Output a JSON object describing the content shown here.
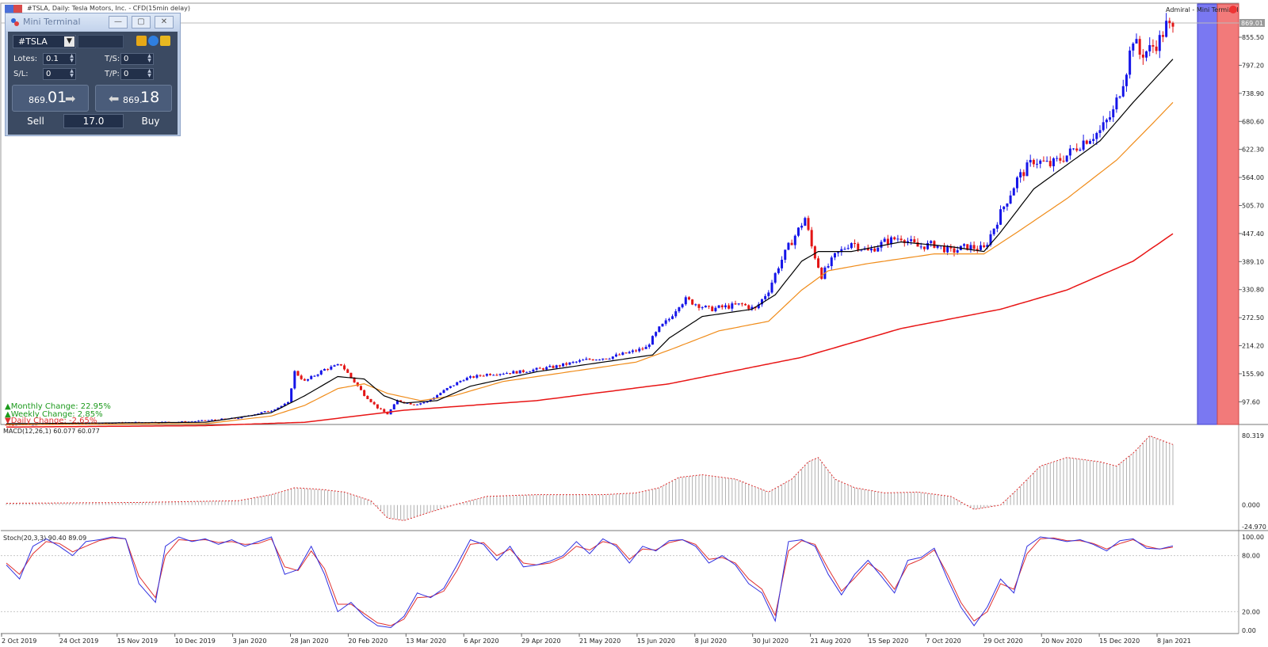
{
  "chart_title": "#TSLA, Daily:  Tesla Motors, Inc. - CFD(15min delay)",
  "top_right_label": "Admiral - Mini Terminal",
  "current_price_tag": "869.01",
  "mini_terminal": {
    "title": "Mini Terminal",
    "symbol": "#TSLA",
    "lots_label": "Lotes:",
    "lots_value": "0.1",
    "ts_label": "T/S:",
    "ts_value": "0",
    "sl_label": "S/L:",
    "sl_value": "0",
    "tp_label": "T/P:",
    "tp_value": "0",
    "sell_price_small": "869.",
    "sell_price_big": "01",
    "buy_price_small": "869.",
    "buy_price_big": "18",
    "sell_label": "Sell",
    "buy_label": "Buy",
    "quantity": "17.0"
  },
  "change_labels": {
    "monthly": "▲Monthly Change: 22.95%",
    "weekly": "▲Weekly Change: 2.85%",
    "daily": "▼Daily Change: -2.65%"
  },
  "macd_label": "MACD(12,26,1) 60.077 60.077",
  "stoch_label": "Stoch(20,3,3) 90.40 89.09",
  "colors": {
    "bull": "#1515e8",
    "bear": "#e31515",
    "ma_fast": "#000000",
    "ma_mid": "#f08c1a",
    "ma_slow": "#e81515",
    "panel_blue": "#7a78f2",
    "panel_red": "#f27a7a",
    "terminal_bg": "#3b4a62"
  },
  "chart_data": [
    {
      "type": "candlestick",
      "title": "#TSLA, Daily:  Tesla Motors, Inc. - CFD(15min delay)",
      "x_tick_labels": [
        "2 Oct 2019",
        "24 Oct 2019",
        "15 Nov 2019",
        "10 Dec 2019",
        "3 Jan 2020",
        "28 Jan 2020",
        "20 Feb 2020",
        "13 Mar 2020",
        "6 Apr 2020",
        "29 Apr 2020",
        "21 May 2020",
        "15 Jun 2020",
        "8 Jul 2020",
        "30 Jul 2020",
        "21 Aug 2020",
        "15 Sep 2020",
        "7 Oct 2020",
        "29 Oct 2020",
        "20 Nov 2020",
        "15 Dec 2020",
        "8 Jan 2021"
      ],
      "y_tick_labels": [
        "855.50",
        "797.20",
        "738.90",
        "680.60",
        "622.30",
        "564.00",
        "505.70",
        "447.40",
        "389.10",
        "330.80",
        "272.50",
        "214.20",
        "155.90",
        "97.60"
      ],
      "y_range": [
        57.0,
        900.0
      ],
      "last_price": 869.01,
      "close_path": [
        [
          0,
          50
        ],
        [
          20,
          52
        ],
        [
          40,
          55
        ],
        [
          55,
          56
        ],
        [
          70,
          64
        ],
        [
          80,
          80
        ],
        [
          85,
          95
        ],
        [
          87,
          160
        ],
        [
          90,
          140
        ],
        [
          96,
          165
        ],
        [
          101,
          175
        ],
        [
          104,
          148
        ],
        [
          108,
          112
        ],
        [
          112,
          85
        ],
        [
          115,
          72
        ],
        [
          118,
          100
        ],
        [
          123,
          92
        ],
        [
          127,
          98
        ],
        [
          133,
          125
        ],
        [
          138,
          145
        ],
        [
          145,
          155
        ],
        [
          155,
          160
        ],
        [
          165,
          170
        ],
        [
          175,
          185
        ],
        [
          182,
          190
        ],
        [
          188,
          200
        ],
        [
          193,
          210
        ],
        [
          197,
          250
        ],
        [
          200,
          270
        ],
        [
          203,
          300
        ],
        [
          205,
          310
        ],
        [
          212,
          290
        ],
        [
          222,
          300
        ],
        [
          226,
          290
        ],
        [
          230,
          330
        ],
        [
          233,
          380
        ],
        [
          236,
          420
        ],
        [
          239,
          455
        ],
        [
          241,
          480
        ],
        [
          243,
          420
        ],
        [
          246,
          360
        ],
        [
          250,
          400
        ],
        [
          255,
          430
        ],
        [
          260,
          410
        ],
        [
          265,
          430
        ],
        [
          270,
          440
        ],
        [
          275,
          420
        ],
        [
          280,
          425
        ],
        [
          285,
          410
        ],
        [
          290,
          420
        ],
        [
          295,
          415
        ],
        [
          300,
          490
        ],
        [
          305,
          560
        ],
        [
          310,
          600
        ],
        [
          315,
          590
        ],
        [
          320,
          610
        ],
        [
          325,
          640
        ],
        [
          330,
          660
        ],
        [
          334,
          700
        ],
        [
          338,
          790
        ],
        [
          340,
          855
        ],
        [
          342,
          820
        ],
        [
          345,
          830
        ],
        [
          348,
          850
        ],
        [
          350,
          880
        ],
        [
          352,
          869
        ]
      ],
      "ma_fast_path": [
        [
          0,
          52
        ],
        [
          60,
          55
        ],
        [
          80,
          75
        ],
        [
          90,
          110
        ],
        [
          100,
          150
        ],
        [
          108,
          145
        ],
        [
          114,
          110
        ],
        [
          120,
          95
        ],
        [
          130,
          100
        ],
        [
          140,
          130
        ],
        [
          160,
          160
        ],
        [
          180,
          180
        ],
        [
          195,
          195
        ],
        [
          200,
          230
        ],
        [
          210,
          275
        ],
        [
          225,
          290
        ],
        [
          232,
          320
        ],
        [
          240,
          390
        ],
        [
          245,
          410
        ],
        [
          255,
          410
        ],
        [
          270,
          430
        ],
        [
          285,
          420
        ],
        [
          295,
          410
        ],
        [
          300,
          450
        ],
        [
          310,
          540
        ],
        [
          320,
          590
        ],
        [
          330,
          640
        ],
        [
          340,
          720
        ],
        [
          352,
          810
        ]
      ],
      "ma_mid_path": [
        [
          0,
          50
        ],
        [
          60,
          52
        ],
        [
          80,
          68
        ],
        [
          90,
          90
        ],
        [
          100,
          125
        ],
        [
          108,
          135
        ],
        [
          115,
          115
        ],
        [
          125,
          100
        ],
        [
          135,
          110
        ],
        [
          150,
          140
        ],
        [
          170,
          160
        ],
        [
          190,
          180
        ],
        [
          200,
          205
        ],
        [
          215,
          245
        ],
        [
          230,
          265
        ],
        [
          240,
          330
        ],
        [
          248,
          370
        ],
        [
          260,
          385
        ],
        [
          280,
          405
        ],
        [
          295,
          405
        ],
        [
          305,
          450
        ],
        [
          320,
          520
        ],
        [
          335,
          600
        ],
        [
          345,
          670
        ],
        [
          352,
          720
        ]
      ],
      "ma_slow_path": [
        [
          0,
          45
        ],
        [
          60,
          48
        ],
        [
          90,
          55
        ],
        [
          120,
          80
        ],
        [
          160,
          100
        ],
        [
          200,
          135
        ],
        [
          240,
          190
        ],
        [
          270,
          250
        ],
        [
          300,
          290
        ],
        [
          320,
          330
        ],
        [
          340,
          390
        ],
        [
          352,
          447
        ]
      ]
    },
    {
      "type": "bar",
      "title": "MACD(12,26,1) 60.077 60.077",
      "y_tick_labels": [
        "80.319",
        "0.000",
        "-24.970"
      ],
      "y_range": [
        -24.97,
        80.319
      ],
      "values_path": [
        [
          0,
          2
        ],
        [
          40,
          3
        ],
        [
          70,
          5
        ],
        [
          80,
          12
        ],
        [
          87,
          20
        ],
        [
          95,
          18
        ],
        [
          102,
          15
        ],
        [
          110,
          5
        ],
        [
          115,
          -15
        ],
        [
          120,
          -18
        ],
        [
          128,
          -8
        ],
        [
          135,
          0
        ],
        [
          145,
          10
        ],
        [
          160,
          12
        ],
        [
          180,
          12
        ],
        [
          190,
          14
        ],
        [
          197,
          20
        ],
        [
          203,
          32
        ],
        [
          210,
          35
        ],
        [
          220,
          30
        ],
        [
          230,
          15
        ],
        [
          237,
          30
        ],
        [
          242,
          50
        ],
        [
          245,
          55
        ],
        [
          250,
          30
        ],
        [
          256,
          20
        ],
        [
          265,
          14
        ],
        [
          275,
          15
        ],
        [
          285,
          10
        ],
        [
          292,
          -5
        ],
        [
          300,
          0
        ],
        [
          305,
          18
        ],
        [
          312,
          45
        ],
        [
          320,
          55
        ],
        [
          330,
          50
        ],
        [
          335,
          45
        ],
        [
          340,
          60
        ],
        [
          345,
          80
        ],
        [
          352,
          70
        ]
      ]
    },
    {
      "type": "line",
      "title": "Stoch(20,3,3) 90.40 89.09",
      "y_tick_labels": [
        "100.00",
        "80.00",
        "20.00",
        "0.00"
      ],
      "y_range": [
        0,
        100
      ],
      "reference_lines": [
        80,
        20
      ],
      "main_path": [
        [
          0,
          70
        ],
        [
          4,
          55
        ],
        [
          8,
          90
        ],
        [
          12,
          98
        ],
        [
          16,
          90
        ],
        [
          20,
          80
        ],
        [
          24,
          95
        ],
        [
          28,
          97
        ],
        [
          32,
          100
        ],
        [
          36,
          98
        ],
        [
          40,
          50
        ],
        [
          45,
          30
        ],
        [
          48,
          90
        ],
        [
          52,
          100
        ],
        [
          56,
          95
        ],
        [
          60,
          98
        ],
        [
          64,
          92
        ],
        [
          68,
          97
        ],
        [
          72,
          90
        ],
        [
          76,
          95
        ],
        [
          80,
          100
        ],
        [
          84,
          60
        ],
        [
          88,
          65
        ],
        [
          92,
          90
        ],
        [
          96,
          60
        ],
        [
          100,
          20
        ],
        [
          104,
          30
        ],
        [
          108,
          15
        ],
        [
          112,
          5
        ],
        [
          116,
          3
        ],
        [
          120,
          15
        ],
        [
          124,
          40
        ],
        [
          128,
          35
        ],
        [
          132,
          45
        ],
        [
          136,
          70
        ],
        [
          140,
          97
        ],
        [
          144,
          92
        ],
        [
          148,
          75
        ],
        [
          152,
          90
        ],
        [
          156,
          68
        ],
        [
          160,
          70
        ],
        [
          164,
          74
        ],
        [
          168,
          80
        ],
        [
          172,
          95
        ],
        [
          176,
          82
        ],
        [
          180,
          98
        ],
        [
          184,
          90
        ],
        [
          188,
          72
        ],
        [
          192,
          90
        ],
        [
          196,
          85
        ],
        [
          200,
          96
        ],
        [
          204,
          97
        ],
        [
          208,
          90
        ],
        [
          212,
          72
        ],
        [
          216,
          80
        ],
        [
          220,
          70
        ],
        [
          224,
          50
        ],
        [
          228,
          40
        ],
        [
          232,
          10
        ],
        [
          236,
          95
        ],
        [
          240,
          97
        ],
        [
          244,
          90
        ],
        [
          248,
          60
        ],
        [
          252,
          38
        ],
        [
          256,
          60
        ],
        [
          260,
          75
        ],
        [
          264,
          58
        ],
        [
          268,
          40
        ],
        [
          272,
          75
        ],
        [
          276,
          78
        ],
        [
          280,
          88
        ],
        [
          284,
          55
        ],
        [
          288,
          25
        ],
        [
          292,
          5
        ],
        [
          296,
          25
        ],
        [
          300,
          55
        ],
        [
          304,
          40
        ],
        [
          308,
          90
        ],
        [
          312,
          100
        ],
        [
          316,
          98
        ],
        [
          320,
          95
        ],
        [
          324,
          97
        ],
        [
          328,
          92
        ],
        [
          332,
          85
        ],
        [
          336,
          96
        ],
        [
          340,
          98
        ],
        [
          344,
          88
        ],
        [
          348,
          87
        ],
        [
          352,
          90.4
        ]
      ],
      "signal_path": [
        [
          0,
          72
        ],
        [
          4,
          60
        ],
        [
          8,
          82
        ],
        [
          12,
          95
        ],
        [
          16,
          93
        ],
        [
          20,
          84
        ],
        [
          24,
          90
        ],
        [
          28,
          96
        ],
        [
          32,
          99
        ],
        [
          36,
          98
        ],
        [
          40,
          58
        ],
        [
          45,
          35
        ],
        [
          48,
          80
        ],
        [
          52,
          97
        ],
        [
          56,
          96
        ],
        [
          60,
          97
        ],
        [
          64,
          94
        ],
        [
          68,
          95
        ],
        [
          72,
          92
        ],
        [
          76,
          93
        ],
        [
          80,
          98
        ],
        [
          84,
          68
        ],
        [
          88,
          64
        ],
        [
          92,
          85
        ],
        [
          96,
          66
        ],
        [
          100,
          28
        ],
        [
          104,
          28
        ],
        [
          108,
          18
        ],
        [
          112,
          8
        ],
        [
          116,
          5
        ],
        [
          120,
          12
        ],
        [
          124,
          35
        ],
        [
          128,
          36
        ],
        [
          132,
          42
        ],
        [
          136,
          64
        ],
        [
          140,
          92
        ],
        [
          144,
          94
        ],
        [
          148,
          80
        ],
        [
          152,
          87
        ],
        [
          156,
          72
        ],
        [
          160,
          70
        ],
        [
          164,
          72
        ],
        [
          168,
          78
        ],
        [
          172,
          90
        ],
        [
          176,
          86
        ],
        [
          180,
          95
        ],
        [
          184,
          92
        ],
        [
          188,
          76
        ],
        [
          192,
          87
        ],
        [
          196,
          86
        ],
        [
          200,
          94
        ],
        [
          204,
          97
        ],
        [
          208,
          92
        ],
        [
          212,
          76
        ],
        [
          216,
          78
        ],
        [
          220,
          72
        ],
        [
          224,
          55
        ],
        [
          228,
          44
        ],
        [
          232,
          16
        ],
        [
          236,
          85
        ],
        [
          240,
          96
        ],
        [
          244,
          92
        ],
        [
          248,
          66
        ],
        [
          252,
          42
        ],
        [
          256,
          56
        ],
        [
          260,
          72
        ],
        [
          264,
          62
        ],
        [
          268,
          44
        ],
        [
          272,
          70
        ],
        [
          276,
          76
        ],
        [
          280,
          86
        ],
        [
          284,
          60
        ],
        [
          288,
          30
        ],
        [
          292,
          10
        ],
        [
          296,
          20
        ],
        [
          300,
          50
        ],
        [
          304,
          44
        ],
        [
          308,
          82
        ],
        [
          312,
          98
        ],
        [
          316,
          99
        ],
        [
          320,
          96
        ],
        [
          324,
          96
        ],
        [
          328,
          93
        ],
        [
          332,
          87
        ],
        [
          336,
          93
        ],
        [
          340,
          97
        ],
        [
          344,
          90
        ],
        [
          348,
          87
        ],
        [
          352,
          89.09
        ]
      ]
    }
  ]
}
